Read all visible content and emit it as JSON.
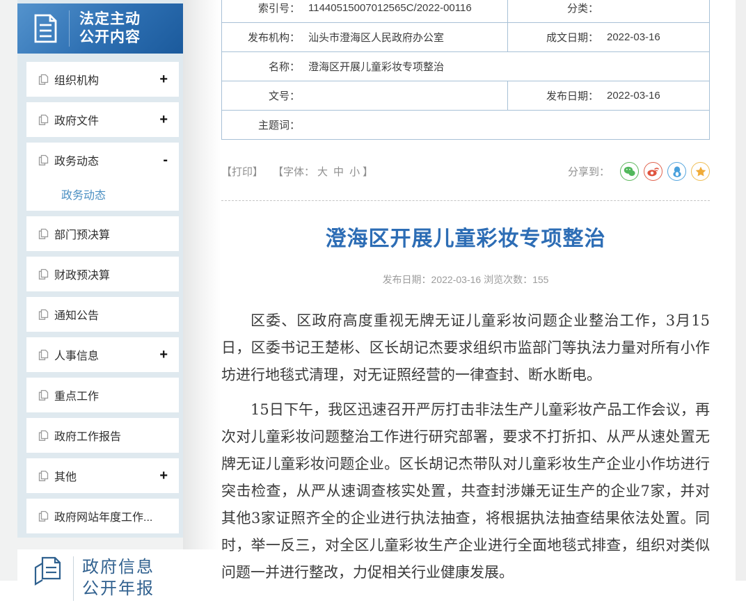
{
  "colors": {
    "accent_blue": "#2d6db5",
    "sidebar_header_gradient_start": "#5493cd",
    "sidebar_header_gradient_end": "#1b5a9c",
    "sidebar_bg": "#dfe9ef",
    "table_border": "#a7c0d6",
    "wechat_green": "#52b85c",
    "weibo_red": "#e0543f",
    "qq_blue": "#48a0dc",
    "qzone_orange": "#f0ab38"
  },
  "sidebar": {
    "header": {
      "title_line1": "法定主动",
      "title_line2": "公开内容"
    },
    "items": [
      {
        "label": "组织机构",
        "toggle": "+"
      },
      {
        "label": "政府文件",
        "toggle": "+"
      },
      {
        "label": "政务动态",
        "toggle": "-",
        "children": [
          {
            "label": "政务动态"
          }
        ]
      },
      {
        "label": "部门预决算",
        "toggle": ""
      },
      {
        "label": "财政预决算",
        "toggle": ""
      },
      {
        "label": "通知公告",
        "toggle": ""
      },
      {
        "label": "人事信息",
        "toggle": "+"
      },
      {
        "label": "重点工作",
        "toggle": ""
      },
      {
        "label": "政府工作报告",
        "toggle": ""
      },
      {
        "label": "其他",
        "toggle": "+"
      },
      {
        "label": "政府网站年度工作...",
        "toggle": ""
      }
    ],
    "annual_report": {
      "title_line1": "政府信息",
      "title_line2": "公开年报"
    }
  },
  "meta_table": {
    "rows": [
      {
        "cells": [
          {
            "label": "索引号：",
            "value": "11440515007012565C/2022-00116"
          },
          {
            "label": "分类：",
            "value": ""
          }
        ]
      },
      {
        "cells": [
          {
            "label": "发布机构：",
            "value": "汕头市澄海区人民政府办公室"
          },
          {
            "label": "成文日期：",
            "value": "2022-03-16"
          }
        ]
      },
      {
        "cells": [
          {
            "label": "名称：",
            "value": "澄海区开展儿童彩妆专项整治"
          }
        ]
      },
      {
        "cells": [
          {
            "label": "文号：",
            "value": ""
          },
          {
            "label": "发布日期：",
            "value": "2022-03-16"
          }
        ]
      },
      {
        "cells": [
          {
            "label": "主题词：",
            "value": ""
          }
        ]
      }
    ]
  },
  "toolbar": {
    "print_label": "【打印】",
    "font_label_prefix": "【字体：",
    "font_sizes": [
      "大",
      "中",
      "小"
    ],
    "font_label_suffix": "】",
    "share_label": "分享到：",
    "share_icons": [
      "wechat-icon",
      "weibo-icon",
      "qq-icon",
      "qzone-icon"
    ]
  },
  "article": {
    "title": "澄海区开展儿童彩妆专项整治",
    "meta": "发布日期：2022-03-16  浏览次数：155",
    "paragraphs": [
      "区委、区政府高度重视无牌无证儿童彩妆问题企业整治工作，3月15日，区委书记王楚彬、区长胡记杰要求组织市监部门等执法力量对所有小作坊进行地毯式清理，对无证照经营的一律查封、断水断电。",
      "15日下午，我区迅速召开严厉打击非法生产儿童彩妆产品工作会议，再次对儿童彩妆问题整治工作进行研究部署，要求不打折扣、从严从速处置无牌无证儿童彩妆问题企业。区长胡记杰带队对儿童彩妆生产企业小作坊进行突击检查，从严从速调查核实处置，共查封涉嫌无证生产的企业7家，并对其他3家证照齐全的企业进行执法抽查，将根据执法抽查结果依法处置。同时，举一反三，对全区儿童彩妆生产企业进行全面地毯式排查，组织对类似问题一并进行整改，力促相关行业健康发展。"
    ]
  }
}
